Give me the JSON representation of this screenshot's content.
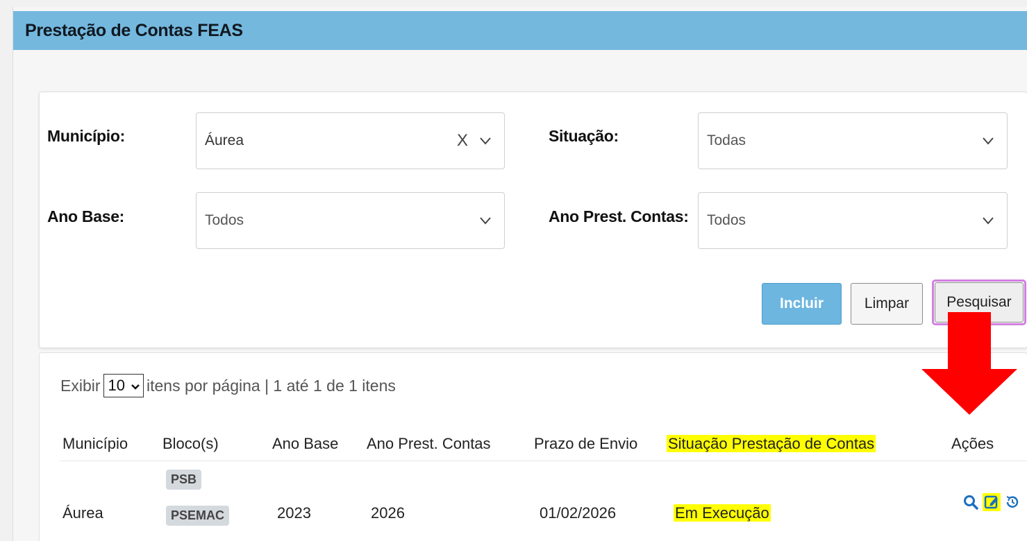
{
  "page": {
    "title": "Prestação de Contas FEAS"
  },
  "filters": {
    "municipio": {
      "label": "Município:",
      "value": "Áurea",
      "clear": "X"
    },
    "situacao": {
      "label": "Situação:",
      "value": "Todas"
    },
    "ano_base": {
      "label": "Ano Base:",
      "value": "Todos"
    },
    "ano_prest": {
      "label": "Ano Prest. Contas:",
      "value": "Todos"
    }
  },
  "buttons": {
    "incluir": "Incluir",
    "limpar": "Limpar",
    "pesquisar": "Pesquisar"
  },
  "pagination": {
    "prefix": "Exibir",
    "page_size": "10",
    "suffix": "itens por página | 1 até 1 de 1 itens"
  },
  "table": {
    "columns": {
      "municipio": "Município",
      "blocos": "Bloco(s)",
      "ano_base": "Ano Base",
      "ano_prest": "Ano Prest. Contas",
      "prazo": "Prazo de Envio",
      "situacao": "Situação Prestação de Contas",
      "acoes": "Ações"
    },
    "rows": [
      {
        "municipio": "Áurea",
        "blocos": [
          "PSB",
          "PSEMAC"
        ],
        "ano_base": "2023",
        "ano_prest": "2026",
        "prazo": "01/02/2026",
        "situacao": "Em Execução"
      }
    ]
  },
  "colors": {
    "header_bg": "#74b8de",
    "highlight": "#ffff00",
    "arrow": "#ff0000",
    "focus_ring": "#d27fe0",
    "action_icon": "#1a6fbf"
  },
  "icons": {
    "search": "search-icon",
    "edit": "edit-icon",
    "history": "history-icon",
    "annotation": "red-arrow-icon"
  }
}
